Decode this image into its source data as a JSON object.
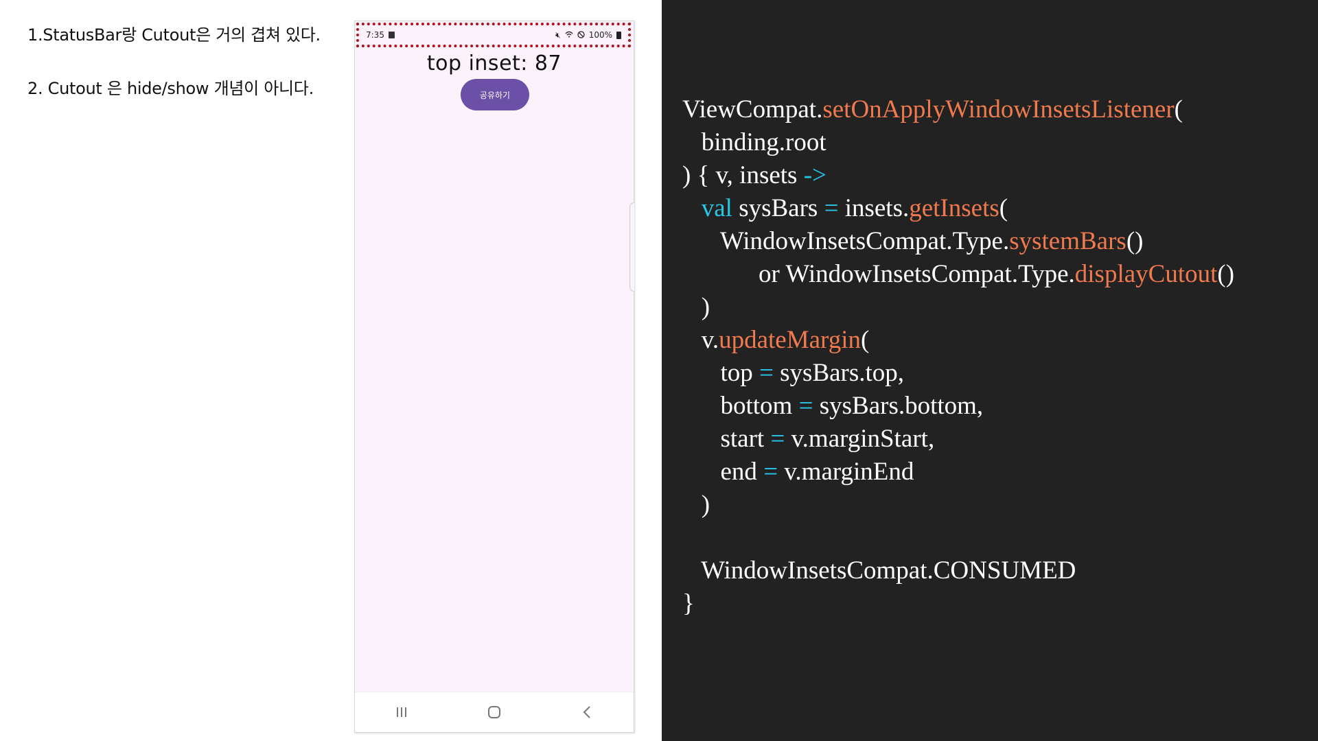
{
  "notes": [
    "1.StatusBar랑 Cutout은 거의 겹쳐 있다.",
    "2. Cutout 은 hide/show 개념이 아니다."
  ],
  "phone": {
    "status_bar": {
      "time": "7:35",
      "battery": "100%",
      "icons": [
        "notification-box-icon",
        "mute-icon",
        "wifi-icon",
        "do-not-disturb-icon",
        "battery-icon"
      ]
    },
    "inset_text": "top inset: 87",
    "share_button": "공유하기",
    "nav_icons": [
      "recents-icon",
      "home-icon",
      "back-icon"
    ]
  },
  "colors": {
    "code_background": "#222222",
    "keyword": "#27c7e8",
    "function": "#f07a4d",
    "highlight_border": "#b0121b",
    "button": "#6c4fa6"
  },
  "code": {
    "lines": [
      [
        {
          "t": "ViewCompat."
        },
        {
          "t": "setOnApplyWindowInsetsListener",
          "c": "fn"
        },
        {
          "t": "("
        }
      ],
      [
        {
          "t": "   binding.root"
        }
      ],
      [
        {
          "t": ") { v, insets "
        },
        {
          "t": "->",
          "c": "kw"
        }
      ],
      [
        {
          "t": "   "
        },
        {
          "t": "val",
          "c": "kw"
        },
        {
          "t": " sysBars "
        },
        {
          "t": "=",
          "c": "kw"
        },
        {
          "t": " insets."
        },
        {
          "t": "getInsets",
          "c": "fn"
        },
        {
          "t": "("
        }
      ],
      [
        {
          "t": "      WindowInsetsCompat.Type."
        },
        {
          "t": "systemBars",
          "c": "fn"
        },
        {
          "t": "()"
        }
      ],
      [
        {
          "t": "            or WindowInsetsCompat.Type."
        },
        {
          "t": "displayCutout",
          "c": "fn"
        },
        {
          "t": "()"
        }
      ],
      [
        {
          "t": "   )"
        }
      ],
      [
        {
          "t": "   v."
        },
        {
          "t": "updateMargin",
          "c": "fn"
        },
        {
          "t": "("
        }
      ],
      [
        {
          "t": "      top "
        },
        {
          "t": "=",
          "c": "kw"
        },
        {
          "t": " sysBars.top,"
        }
      ],
      [
        {
          "t": "      bottom "
        },
        {
          "t": "=",
          "c": "kw"
        },
        {
          "t": " sysBars.bottom,"
        }
      ],
      [
        {
          "t": "      start "
        },
        {
          "t": "=",
          "c": "kw"
        },
        {
          "t": " v.marginStart,"
        }
      ],
      [
        {
          "t": "      end "
        },
        {
          "t": "=",
          "c": "kw"
        },
        {
          "t": " v.marginEnd"
        }
      ],
      [
        {
          "t": "   )"
        }
      ],
      [
        {
          "t": ""
        }
      ],
      [
        {
          "t": "   WindowInsetsCompat.CONSUMED"
        }
      ],
      [
        {
          "t": "}"
        }
      ]
    ]
  }
}
